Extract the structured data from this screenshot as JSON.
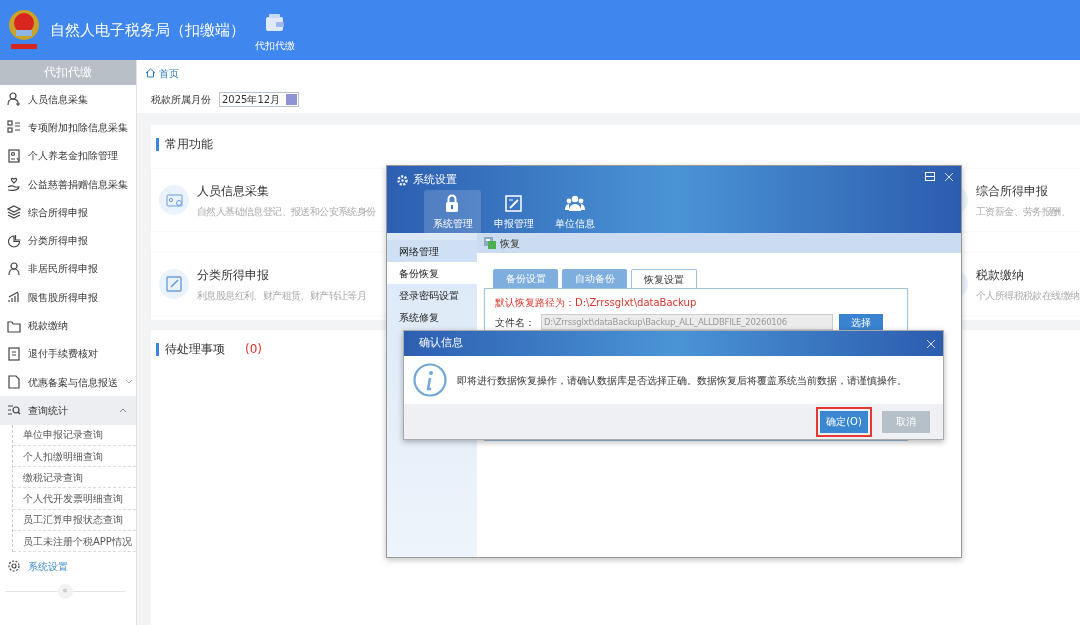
{
  "header": {
    "title": "自然人电子税务局（扣缴端）",
    "nav": [
      {
        "label": "代扣代缴",
        "selected": true
      }
    ]
  },
  "sidebar": {
    "title": "代扣代缴",
    "items": [
      {
        "label": "人员信息采集",
        "selected": false
      },
      {
        "label": "专项附加扣除信息采集",
        "selected": false
      },
      {
        "label": "个人养老金扣除管理",
        "selected": false
      },
      {
        "label": "公益慈善捐赠信息采集",
        "selected": false
      },
      {
        "label": "综合所得申报",
        "selected": false
      },
      {
        "label": "分类所得申报",
        "selected": false
      },
      {
        "label": "非居民所得申报",
        "selected": false
      },
      {
        "label": "限售股所得申报",
        "selected": false
      },
      {
        "label": "税款缴纳",
        "selected": false
      },
      {
        "label": "退付手续费核对",
        "selected": false
      },
      {
        "label": "优惠备案与信息报送",
        "selected": false,
        "expanded": false
      },
      {
        "label": "查询统计",
        "selected": false,
        "expanded": true,
        "children": [
          {
            "label": "单位申报记录查询"
          },
          {
            "label": "个人扣缴明细查询"
          },
          {
            "label": "缴税记录查询"
          },
          {
            "label": "个人代开发票明细查询"
          },
          {
            "label": "员工汇算申报状态查询"
          },
          {
            "label": "员工未注册个税APP情况"
          }
        ]
      },
      {
        "label": "系统设置",
        "selected": true
      }
    ],
    "collapse": "«"
  },
  "breadcrumb": [
    "首页"
  ],
  "period": {
    "label": "税款所属月份",
    "value": "2025年12月"
  },
  "common": {
    "title": "常用功能",
    "functions": [
      {
        "title": "人员信息采集",
        "description": "自然人基础信息登记、报送和公安系统身份"
      },
      {
        "title": "综合所得申报",
        "description": "工资薪金、劳务报酬、"
      },
      {
        "title": "分类所得申报",
        "description": "利息股息红利、财产租赁、财产转让等月"
      },
      {
        "title": "税款缴纳",
        "description": "个人所得税税款在线缴纳"
      }
    ]
  },
  "pending": {
    "title": "待处理事项",
    "count": "(0)"
  },
  "settings_dialog": {
    "title": "系统设置",
    "tabs": [
      {
        "label": "系统管理",
        "selected": true
      },
      {
        "label": "申报管理",
        "selected": false
      },
      {
        "label": "单位信息",
        "selected": false
      }
    ],
    "nav": [
      {
        "label": "网络管理",
        "selected": false
      },
      {
        "label": "备份恢复",
        "selected": true
      },
      {
        "label": "登录密码设置",
        "selected": false
      },
      {
        "label": "系统修复",
        "selected": false
      }
    ],
    "section": "恢复",
    "subtabs": [
      {
        "label": "备份设置",
        "selected": false
      },
      {
        "label": "自动备份",
        "selected": false
      },
      {
        "label": "恢复设置",
        "selected": true
      }
    ],
    "default_path": "默认恢复路径为：D:\\Zrrssglxt\\dataBackup",
    "file": {
      "label": "文件名：",
      "value": "D:\\Zrrssglxt\\dataBackup\\Backup_ALL_ALLDBFILE_20260106",
      "button": "选择"
    }
  },
  "confirm_dialog": {
    "title": "确认信息",
    "message": "即将进行数据恢复操作，请确认数据库是否选择正确。数据恢复后将覆盖系统当前数据，请谨慎操作。",
    "buttons": [
      {
        "label": "确定(O)",
        "kind": "primary",
        "highlighted": true
      },
      {
        "label": "取消",
        "kind": "secondary",
        "highlighted": false
      }
    ]
  }
}
